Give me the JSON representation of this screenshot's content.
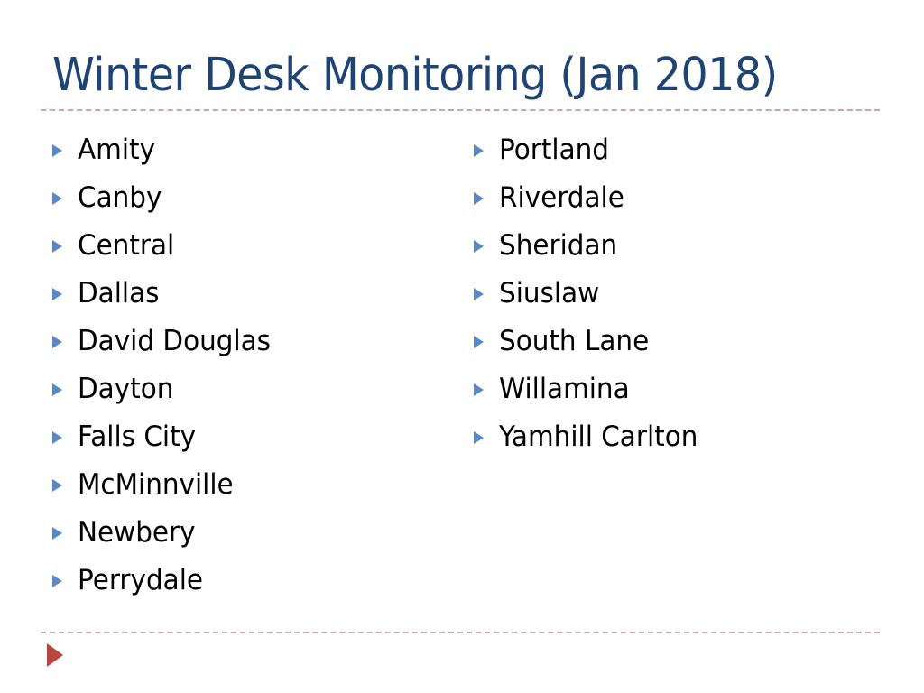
{
  "slide": {
    "title": "Winter Desk Monitoring (Jan 2018)",
    "title_color": "#1F4373",
    "background_color": "#FFFFFF",
    "rule_color": "#C9A3AD",
    "bullet_color": "#5B87C5",
    "footer_bullet_color": "#B9453F",
    "body_text_color": "#000000",
    "columns": {
      "left": [
        {
          "label": "Amity"
        },
        {
          "label": "Canby"
        },
        {
          "label": "Central"
        },
        {
          "label": "Dallas"
        },
        {
          "label": "David Douglas"
        },
        {
          "label": "Dayton"
        },
        {
          "label": "Falls City"
        },
        {
          "label": "McMinnville"
        },
        {
          "label": "Newbery"
        },
        {
          "label": "Perrydale"
        }
      ],
      "right": [
        {
          "label": "Portland"
        },
        {
          "label": "Riverdale"
        },
        {
          "label": "Sheridan"
        },
        {
          "label": "Siuslaw"
        },
        {
          "label": "South Lane"
        },
        {
          "label": "Willamina"
        },
        {
          "label": "Yamhill Carlton"
        }
      ]
    },
    "footer": {
      "bullet_icon": "triangle-right-icon"
    },
    "icons": {
      "bullet": "triangle-right-icon"
    }
  }
}
